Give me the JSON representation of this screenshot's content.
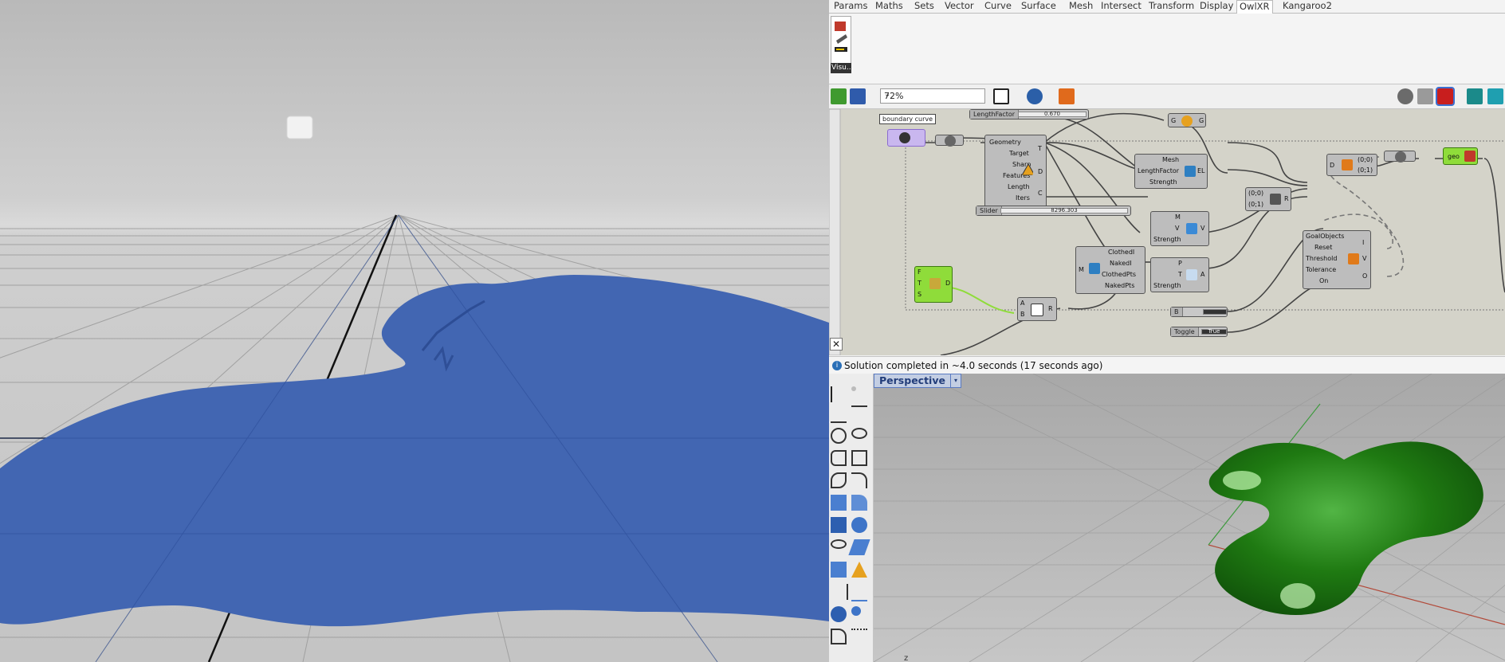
{
  "tabs": [
    "Params",
    "Maths",
    "Sets",
    "Vector",
    "Curve",
    "Surface",
    "Mesh",
    "Intersect",
    "Transform",
    "Display",
    "OwlXR",
    "Kangaroo2"
  ],
  "active_tab": "OwlXR",
  "ribbon": {
    "button_label": "Visu..."
  },
  "toolbar": {
    "zoom": "72%"
  },
  "canvas": {
    "tooltip": "boundary curve",
    "length_slider": {
      "name": "LengthFactor",
      "value": "0.670"
    },
    "main_slider": {
      "name": "Slider",
      "value": "8296.303"
    },
    "remesher": {
      "inputs": [
        "Geometry",
        "Target",
        "Sharp",
        "Features",
        "Length",
        "Iters"
      ],
      "outputs": [
        "T",
        "D",
        "C"
      ]
    },
    "mesh_goal": {
      "inputs": [
        "Mesh",
        "LengthFactor",
        "Strength"
      ],
      "outputs": [
        "EL"
      ]
    },
    "vol_goal": {
      "inputs": [
        "M",
        "V",
        "Strength"
      ],
      "outputs": [
        "V"
      ]
    },
    "naked_comp": {
      "inputs": [
        "M"
      ],
      "outputs": [
        "ClothedI",
        "NakedI",
        "ClothedPts",
        "NakedPts"
      ]
    },
    "anchor_goal": {
      "inputs": [
        "P",
        "T",
        "Strength"
      ],
      "outputs": [
        "A"
      ]
    },
    "multiply": {
      "inputs": [
        "A",
        "B"
      ],
      "outputs": [
        "R"
      ]
    },
    "construct": {
      "inputs": [
        "(0;0)",
        "(0;1)"
      ],
      "outputs": [
        "R"
      ]
    },
    "solver": {
      "inputs": [
        "GoalObjects",
        "Reset",
        "Threshold",
        "Tolerance",
        "On"
      ],
      "outputs": [
        "I",
        "V",
        "O"
      ]
    },
    "list": {
      "inputs": [
        "D"
      ],
      "outputs": [
        "(0;0)",
        "(0;1)"
      ]
    },
    "geo_label": "geo",
    "gg": {
      "left": "G",
      "right": "G"
    },
    "green_inputs": [
      "F",
      "T",
      "S"
    ],
    "green_output": "D",
    "button_label": "B",
    "toggle": {
      "name": "Toggle",
      "value": "True"
    }
  },
  "status": "Solution completed in ~4.0 seconds (17 seconds ago)",
  "viewport": {
    "label": "Perspective",
    "axis_label": "z"
  },
  "colors": {
    "vr_mesh": "#4266b2",
    "rhino_mesh": "#1f7a12",
    "accent": "#2a6fb7"
  }
}
